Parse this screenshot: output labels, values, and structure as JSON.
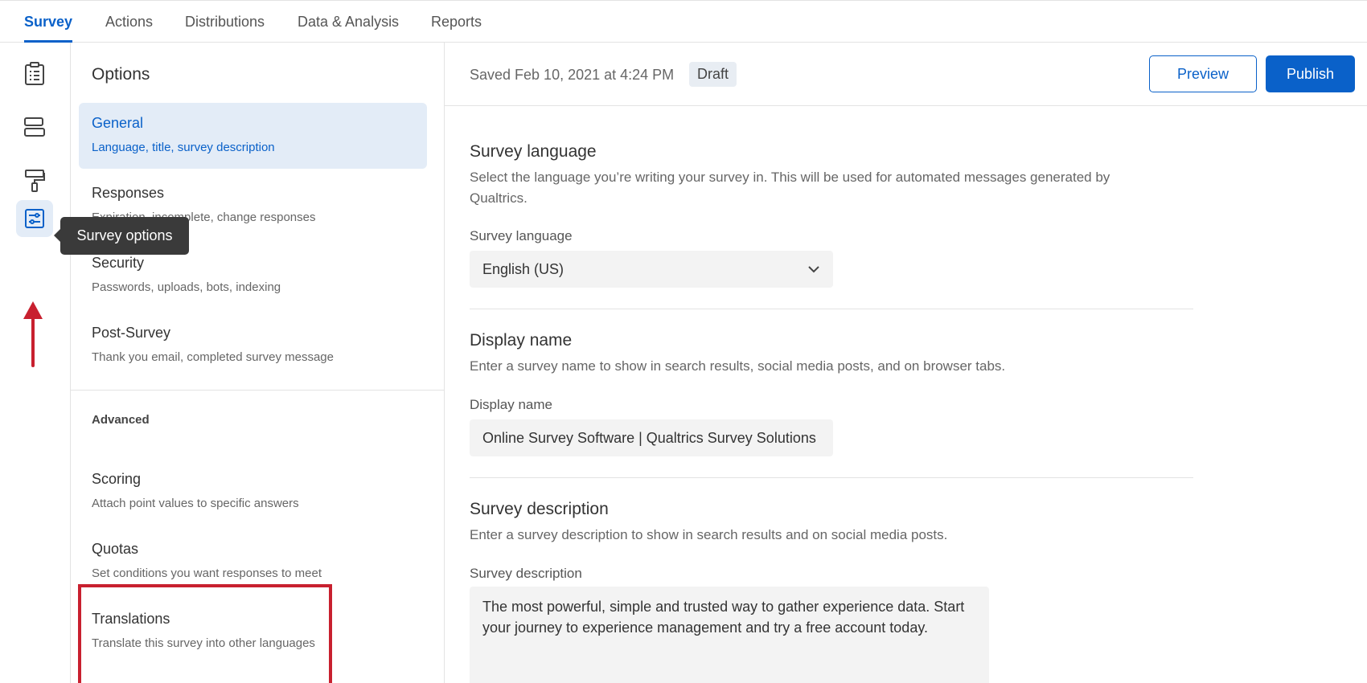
{
  "nav": {
    "tabs": [
      "Survey",
      "Actions",
      "Distributions",
      "Data & Analysis",
      "Reports"
    ]
  },
  "rail": {
    "icons": [
      "clipboard-icon",
      "survey-flow-icon",
      "paint-roller-icon",
      "survey-options-icon"
    ],
    "tooltip": "Survey options"
  },
  "options": {
    "title": "Options",
    "items": [
      {
        "title": "General",
        "desc": "Language, title, survey description"
      },
      {
        "title": "Responses",
        "desc": "Expiration, incomplete, change responses"
      },
      {
        "title": "Security",
        "desc": "Passwords, uploads, bots, indexing"
      },
      {
        "title": "Post-Survey",
        "desc": "Thank you email, completed survey message"
      }
    ],
    "advanced_label": "Advanced",
    "advanced_items": [
      {
        "title": "Scoring",
        "desc": "Attach point values to specific answers"
      },
      {
        "title": "Quotas",
        "desc": "Set conditions you want responses to meet"
      },
      {
        "title": "Translations",
        "desc": "Translate this survey into other languages"
      }
    ]
  },
  "header": {
    "saved": "Saved Feb 10, 2021 at 4:24 PM",
    "status": "Draft",
    "preview_label": "Preview",
    "publish_label": "Publish"
  },
  "language": {
    "title": "Survey language",
    "desc": "Select the language you’re writing your survey in. This will be used for automated messages generated by Qualtrics.",
    "label": "Survey language",
    "value": "English (US)"
  },
  "display_name": {
    "title": "Display name",
    "desc": "Enter a survey name to show in search results, social media posts, and on browser tabs.",
    "label": "Display name",
    "value": "Online Survey Software | Qualtrics Survey Solutions"
  },
  "description": {
    "title": "Survey description",
    "desc": "Enter a survey description to show in search results and on social media posts.",
    "label": "Survey description",
    "value": "The most powerful, simple and trusted way to gather experience data. Start your journey to experience management and try a free account today."
  },
  "colors": {
    "accent": "#0a61c9",
    "highlight": "#c8202f",
    "tooltip_bg": "#3a3a3a"
  }
}
